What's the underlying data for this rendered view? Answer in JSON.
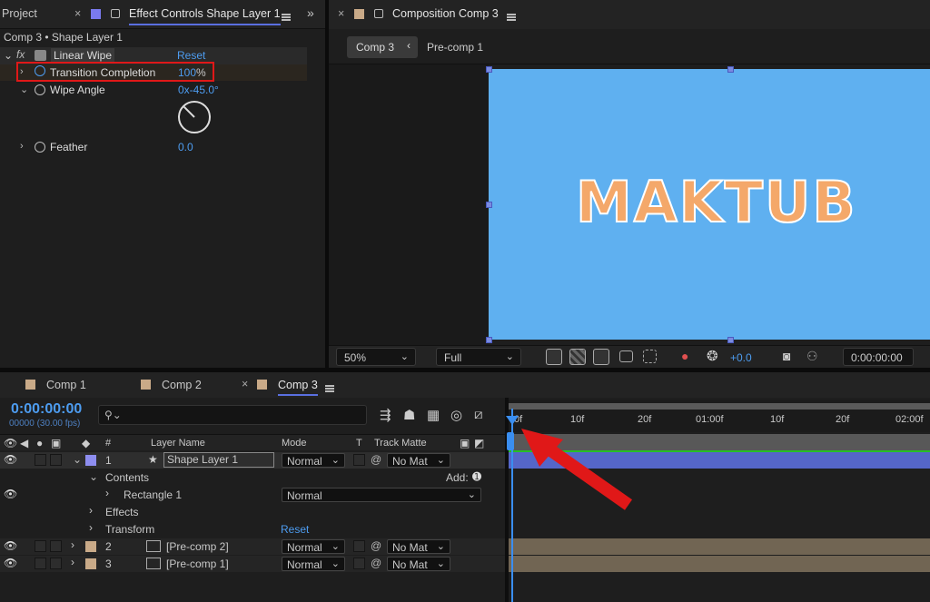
{
  "left": {
    "tab_project": "Project",
    "tab_effect": "Effect Controls Shape Layer 1",
    "breadcrumb": "Comp 3 • Shape Layer 1",
    "effect_name": "Linear Wipe",
    "reset": "Reset",
    "props": [
      {
        "label": "Transition Completion",
        "value": "100",
        "unit": "%"
      },
      {
        "label": "Wipe Angle",
        "value": "0x-45.0",
        "unit": "°"
      },
      {
        "label": "Feather",
        "value": "0.0",
        "unit": ""
      }
    ],
    "dial_angle_deg": -45
  },
  "comp": {
    "tab_title": "Composition Comp 3",
    "crumb_active": "Comp 3",
    "crumb_next": "Pre-comp 1",
    "canvas_text": "MAKTUB",
    "canvas_color": "#5fb0f0",
    "text_color": "#f4a86a",
    "zoom": "50%",
    "resolution": "Full",
    "exposure": "+0.0",
    "timecode": "0:00:00:00"
  },
  "timeline": {
    "tabs": [
      "Comp 1",
      "Comp 2",
      "Comp 3"
    ],
    "timecode": "0:00:00:00",
    "fps": "00000 (30.00 fps)",
    "search_placeholder": "",
    "headers": {
      "num": "#",
      "layer_name": "Layer Name",
      "mode": "Mode",
      "t": "T",
      "track_matte": "Track Matte"
    },
    "ruler": [
      "0f",
      "10f",
      "20f",
      "01:00f",
      "10f",
      "20f",
      "02:00f"
    ],
    "add": "Add:",
    "layers": [
      {
        "num": "1",
        "name": "Shape Layer 1",
        "mode": "Normal",
        "matte": "No Mat",
        "color": "#8e8ef0"
      },
      {
        "num": "2",
        "name": "[Pre-comp 2]",
        "mode": "Normal",
        "matte": "No Mat",
        "color": "#c9aa88"
      },
      {
        "num": "3",
        "name": "[Pre-comp 1]",
        "mode": "Normal",
        "matte": "No Mat",
        "color": "#c9aa88"
      }
    ],
    "sub": {
      "contents": "Contents",
      "rectangle": "Rectangle 1",
      "rect_mode": "Normal",
      "effects": "Effects",
      "transform": "Transform",
      "reset": "Reset"
    }
  }
}
